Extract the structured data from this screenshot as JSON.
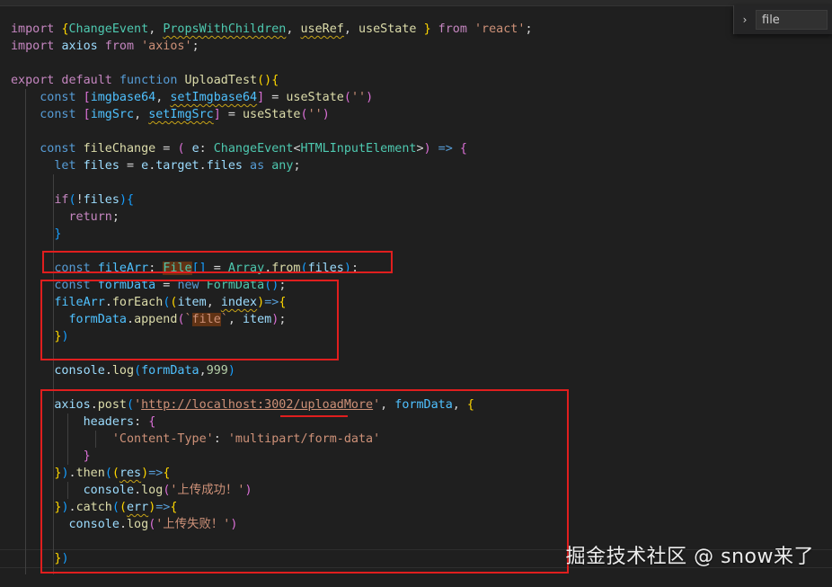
{
  "editor": {
    "find_widget": {
      "toggle_icon": "chevron-right-icon",
      "value": "file"
    },
    "watermark": "掘金技术社区 @ snow来了",
    "lines": [
      [
        [
          "k",
          "import "
        ],
        [
          "b1",
          "{"
        ],
        [
          "t",
          "ChangeEvent"
        ],
        [
          "p",
          ", "
        ],
        [
          "t sq",
          "PropsWithChildren"
        ],
        [
          "p",
          ", "
        ],
        [
          "f sq",
          "useRef"
        ],
        [
          "p",
          ", "
        ],
        [
          "f",
          "useState"
        ],
        [
          "p",
          " "
        ],
        [
          "b1",
          "}"
        ],
        [
          "k",
          " from "
        ],
        [
          "s",
          "'react'"
        ],
        [
          "p",
          ";"
        ]
      ],
      [
        [
          "k",
          "import "
        ],
        [
          "v",
          "axios"
        ],
        [
          "k",
          " from "
        ],
        [
          "s",
          "'axios'"
        ],
        [
          "p",
          ";"
        ]
      ],
      [],
      [
        [
          "k",
          "export default "
        ],
        [
          "b",
          "function "
        ],
        [
          "f",
          "UploadTest"
        ],
        [
          "b1",
          "()"
        ],
        [
          "b1",
          "{"
        ]
      ],
      [
        [
          "p",
          "    "
        ],
        [
          "b",
          "const "
        ],
        [
          "b2",
          "["
        ],
        [
          "c",
          "imgbase64"
        ],
        [
          "p",
          ", "
        ],
        [
          "c sq",
          "setImgbase64"
        ],
        [
          "b2",
          "]"
        ],
        [
          "p",
          " = "
        ],
        [
          "f",
          "useState"
        ],
        [
          "b2",
          "("
        ],
        [
          "s",
          "''"
        ],
        [
          "b2",
          ")"
        ]
      ],
      [
        [
          "p",
          "    "
        ],
        [
          "b",
          "const "
        ],
        [
          "b2",
          "["
        ],
        [
          "c",
          "imgSrc"
        ],
        [
          "p",
          ", "
        ],
        [
          "c sq",
          "setImgSrc"
        ],
        [
          "b2",
          "]"
        ],
        [
          "p",
          " = "
        ],
        [
          "f",
          "useState"
        ],
        [
          "b2",
          "("
        ],
        [
          "s",
          "''"
        ],
        [
          "b2",
          ")"
        ]
      ],
      [],
      [
        [
          "p",
          "    "
        ],
        [
          "b",
          "const "
        ],
        [
          "f",
          "fileChange"
        ],
        [
          "p",
          " = "
        ],
        [
          "b2",
          "("
        ],
        [
          "p",
          " "
        ],
        [
          "v",
          "e"
        ],
        [
          "p",
          ": "
        ],
        [
          "t",
          "ChangeEvent"
        ],
        [
          "p",
          "<"
        ],
        [
          "t",
          "HTMLInputElement"
        ],
        [
          "p",
          ">"
        ],
        [
          "b2",
          ")"
        ],
        [
          "b",
          " => "
        ],
        [
          "b2",
          "{"
        ]
      ],
      [
        [
          "p",
          "      "
        ],
        [
          "b",
          "let "
        ],
        [
          "v",
          "files"
        ],
        [
          "p",
          " = "
        ],
        [
          "v",
          "e"
        ],
        [
          "p",
          "."
        ],
        [
          "v",
          "target"
        ],
        [
          "p",
          "."
        ],
        [
          "v",
          "files"
        ],
        [
          "b",
          " as "
        ],
        [
          "t",
          "any"
        ],
        [
          "p",
          ";"
        ]
      ],
      [],
      [
        [
          "p",
          "      "
        ],
        [
          "k",
          "if"
        ],
        [
          "b3",
          "("
        ],
        [
          "p",
          "!"
        ],
        [
          "v",
          "files"
        ],
        [
          "b3",
          ")"
        ],
        [
          "b3",
          "{"
        ]
      ],
      [
        [
          "p",
          "        "
        ],
        [
          "k",
          "return"
        ],
        [
          "p",
          ";"
        ]
      ],
      [
        [
          "p",
          "      "
        ],
        [
          "b3",
          "}"
        ]
      ],
      [],
      [
        [
          "p",
          "      "
        ],
        [
          "b",
          "const "
        ],
        [
          "c",
          "fileArr"
        ],
        [
          "p",
          ": "
        ],
        [
          "t hl",
          "File"
        ],
        [
          "b3",
          "[]"
        ],
        [
          "p",
          " = "
        ],
        [
          "t",
          "Array"
        ],
        [
          "p",
          "."
        ],
        [
          "f",
          "from"
        ],
        [
          "b3",
          "("
        ],
        [
          "v",
          "files"
        ],
        [
          "b3",
          ")"
        ],
        [
          "p",
          ";"
        ]
      ],
      [
        [
          "p",
          "      "
        ],
        [
          "b",
          "const "
        ],
        [
          "c",
          "formData"
        ],
        [
          "p",
          " = "
        ],
        [
          "b",
          "new "
        ],
        [
          "t",
          "FormData"
        ],
        [
          "b3",
          "()"
        ],
        [
          "p",
          ";"
        ]
      ],
      [
        [
          "p",
          "      "
        ],
        [
          "c",
          "fileArr"
        ],
        [
          "p",
          "."
        ],
        [
          "f",
          "forEach"
        ],
        [
          "b3",
          "("
        ],
        [
          "b1",
          "("
        ],
        [
          "v",
          "item"
        ],
        [
          "p",
          ", "
        ],
        [
          "v sq",
          "index"
        ],
        [
          "b1",
          ")"
        ],
        [
          "b",
          "=>"
        ],
        [
          "b1",
          "{"
        ]
      ],
      [
        [
          "p",
          "        "
        ],
        [
          "c",
          "formData"
        ],
        [
          "p",
          "."
        ],
        [
          "f",
          "append"
        ],
        [
          "b2",
          "("
        ],
        [
          "s",
          "`"
        ],
        [
          "s hl",
          "file"
        ],
        [
          "s",
          "`"
        ],
        [
          "p",
          ", "
        ],
        [
          "v",
          "item"
        ],
        [
          "b2",
          ")"
        ],
        [
          "p",
          ";"
        ]
      ],
      [
        [
          "p",
          "      "
        ],
        [
          "b1",
          "}"
        ],
        [
          "b3",
          ")"
        ]
      ],
      [],
      [
        [
          "p",
          "      "
        ],
        [
          "v",
          "console"
        ],
        [
          "p",
          "."
        ],
        [
          "f",
          "log"
        ],
        [
          "b3",
          "("
        ],
        [
          "c",
          "formData"
        ],
        [
          "p",
          ","
        ],
        [
          "n",
          "999"
        ],
        [
          "b3",
          ")"
        ]
      ],
      [],
      [
        [
          "p",
          "      "
        ],
        [
          "v",
          "axios"
        ],
        [
          "p",
          "."
        ],
        [
          "f",
          "post"
        ],
        [
          "b3",
          "("
        ],
        [
          "s",
          "'"
        ],
        [
          "s ul",
          "http://localhost:3002/uploadMore"
        ],
        [
          "s",
          "'"
        ],
        [
          "p",
          ", "
        ],
        [
          "c",
          "formData"
        ],
        [
          "p",
          ", "
        ],
        [
          "b1",
          "{"
        ]
      ],
      [
        [
          "p",
          "          "
        ],
        [
          "v",
          "headers"
        ],
        [
          "p",
          ": "
        ],
        [
          "b2",
          "{"
        ]
      ],
      [
        [
          "p",
          "              "
        ],
        [
          "s",
          "'Content-Type'"
        ],
        [
          "p",
          ": "
        ],
        [
          "s",
          "'multipart/form-data'"
        ]
      ],
      [
        [
          "p",
          "          "
        ],
        [
          "b2",
          "}"
        ]
      ],
      [
        [
          "p",
          "      "
        ],
        [
          "b1",
          "}"
        ],
        [
          "b3",
          ")"
        ],
        [
          "p",
          "."
        ],
        [
          "f",
          "then"
        ],
        [
          "b3",
          "("
        ],
        [
          "b1",
          "("
        ],
        [
          "v sq",
          "res"
        ],
        [
          "b1",
          ")"
        ],
        [
          "b",
          "=>"
        ],
        [
          "b1",
          "{"
        ]
      ],
      [
        [
          "p",
          "          "
        ],
        [
          "v",
          "console"
        ],
        [
          "p",
          "."
        ],
        [
          "f",
          "log"
        ],
        [
          "b2",
          "("
        ],
        [
          "s",
          "'上传成功！'"
        ],
        [
          "b2",
          ")"
        ]
      ],
      [
        [
          "p",
          "      "
        ],
        [
          "b1",
          "}"
        ],
        [
          "b3",
          ")"
        ],
        [
          "p",
          "."
        ],
        [
          "f",
          "catch"
        ],
        [
          "b3",
          "("
        ],
        [
          "b1",
          "("
        ],
        [
          "v sq",
          "err"
        ],
        [
          "b1",
          ")"
        ],
        [
          "b",
          "=>"
        ],
        [
          "b1",
          "{"
        ]
      ],
      [
        [
          "p",
          "        "
        ],
        [
          "v",
          "console"
        ],
        [
          "p",
          "."
        ],
        [
          "f",
          "log"
        ],
        [
          "b2",
          "("
        ],
        [
          "s",
          "'上传失败！'"
        ],
        [
          "b2",
          ")"
        ]
      ],
      [],
      [
        [
          "p",
          "      "
        ],
        [
          "b1",
          "}"
        ],
        [
          "b3",
          ")"
        ]
      ]
    ]
  }
}
